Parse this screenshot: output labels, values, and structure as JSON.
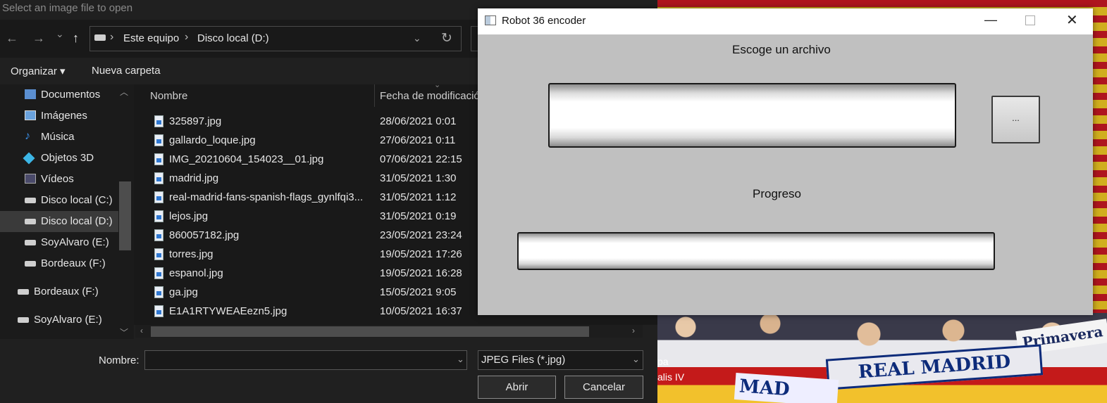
{
  "file_dialog": {
    "title": "Select an image file to open",
    "nav": {
      "back": "←",
      "forward": "→",
      "recent": "⌄",
      "up": "↑"
    },
    "breadcrumb": [
      "Este equipo",
      "Disco local (D:)"
    ],
    "toolbar": {
      "organize": "Organizar ▾",
      "new_folder": "Nueva carpeta"
    },
    "sidebar": [
      {
        "label": "Documentos",
        "icon": "documents-icon"
      },
      {
        "label": "Imágenes",
        "icon": "images-icon"
      },
      {
        "label": "Música",
        "icon": "music-icon"
      },
      {
        "label": "Objetos 3D",
        "icon": "3d-objects-icon"
      },
      {
        "label": "Vídeos",
        "icon": "videos-icon"
      },
      {
        "label": "Disco local (C:)",
        "icon": "drive-icon"
      },
      {
        "label": "Disco local (D:)",
        "icon": "drive-icon",
        "selected": true
      },
      {
        "label": "SoyAlvaro (E:)",
        "icon": "drive-icon"
      },
      {
        "label": "Bordeaux (F:)",
        "icon": "drive-icon"
      },
      {
        "label": "Bordeaux (F:)",
        "icon": "drive-icon"
      },
      {
        "label": "SoyAlvaro (E:)",
        "icon": "drive-icon"
      }
    ],
    "columns": {
      "name": "Nombre",
      "date": "Fecha de modificació"
    },
    "files": [
      {
        "name": "325897.jpg",
        "date": "28/06/2021 0:01"
      },
      {
        "name": "gallardo_loque.jpg",
        "date": "27/06/2021 0:11"
      },
      {
        "name": "IMG_20210604_154023__01.jpg",
        "date": "07/06/2021 22:15"
      },
      {
        "name": "madrid.jpg",
        "date": "31/05/2021 1:30"
      },
      {
        "name": "real-madrid-fans-spanish-flags_gynlfqi3...",
        "date": "31/05/2021 1:12"
      },
      {
        "name": "lejos.jpg",
        "date": "31/05/2021 0:19"
      },
      {
        "name": "860057182.jpg",
        "date": "23/05/2021 23:24"
      },
      {
        "name": "torres.jpg",
        "date": "19/05/2021 17:26"
      },
      {
        "name": "espanol.jpg",
        "date": "19/05/2021 16:28"
      },
      {
        "name": "ga.jpg",
        "date": "15/05/2021 9:05"
      },
      {
        "name": "E1A1RTYWEAEezn5.jpg",
        "date": "10/05/2021 16:37"
      }
    ],
    "filename_label": "Nombre:",
    "filename_value": "",
    "filetype": "JPEG Files (*.jpg)",
    "open_label": "Abrir",
    "cancel_label": "Cancelar"
  },
  "robot_window": {
    "title": "Robot 36 encoder",
    "choose_label": "Escoge un archivo",
    "browse_label": "...",
    "progress_label": "Progreso",
    "progress_value": 0
  },
  "background": {
    "scarf_text": "REAL MADRID",
    "scarf_text2": "MAD",
    "banner_text": "Primavera",
    "desktop_text1": "pa",
    "desktop_text2": "alis IV"
  }
}
